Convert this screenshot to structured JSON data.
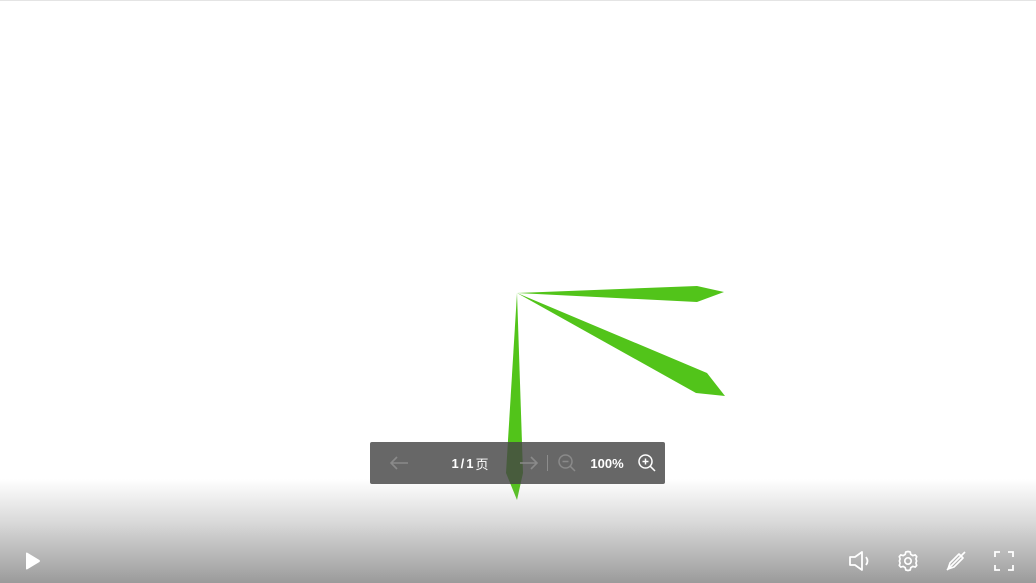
{
  "toolbar": {
    "prev_icon": "arrow-left-icon",
    "page_current": "1",
    "page_separator": "/",
    "page_total": "1",
    "page_unit": "页",
    "next_icon": "arrow-right-icon",
    "zoom_out_icon": "zoom-out-icon",
    "zoom_level": "100%",
    "zoom_in_icon": "zoom-in-icon"
  },
  "player_controls": {
    "play_icon": "play-icon",
    "volume_icon": "volume-icon",
    "settings_icon": "gear-icon",
    "annotate_icon": "pen-slash-icon",
    "fullscreen_icon": "fullscreen-icon"
  },
  "colors": {
    "arrow": "#52c41a",
    "toolbar_bg": "#464646",
    "icon": "#ffffff"
  }
}
